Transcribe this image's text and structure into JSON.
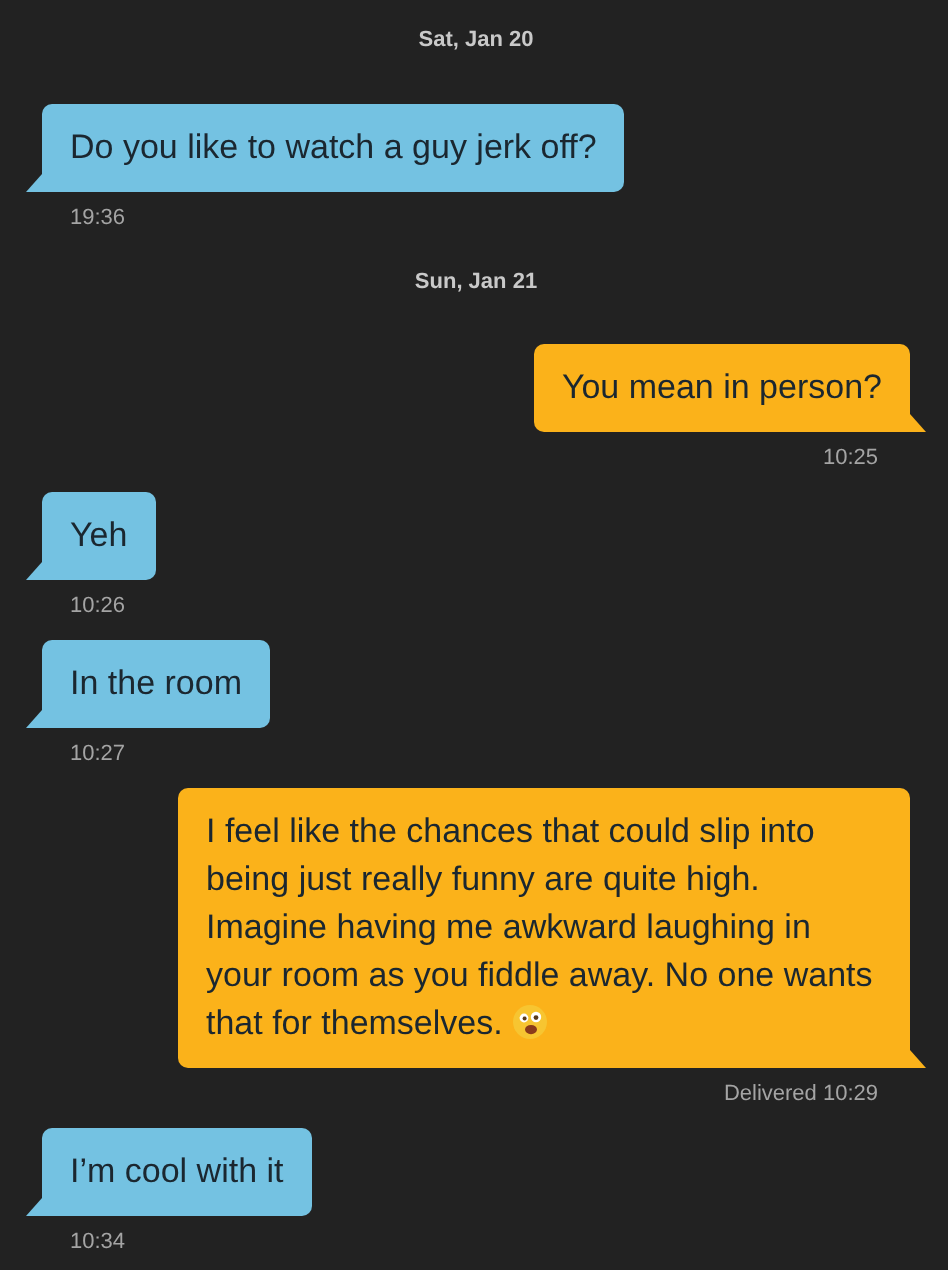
{
  "messages": [
    {
      "kind": "date",
      "text": "Sat, Jan 20"
    },
    {
      "kind": "incoming",
      "text": "Do you like to watch a guy jerk off?",
      "time": "19:36"
    },
    {
      "kind": "date",
      "text": "Sun, Jan 21"
    },
    {
      "kind": "outgoing",
      "text": "You mean in person?",
      "time": "10:25"
    },
    {
      "kind": "incoming",
      "text": "Yeh",
      "time": "10:26"
    },
    {
      "kind": "incoming",
      "text": "In the room",
      "time": "10:27"
    },
    {
      "kind": "outgoing",
      "text": "I feel like the chances that could slip into being just really funny are quite high. Imagine having me awkward laughing in your room as you fiddle away. No one wants that for themselves.",
      "emoji": true,
      "time": "Delivered 10:29"
    },
    {
      "kind": "incoming",
      "text": "I’m cool with it",
      "time": "10:34"
    }
  ]
}
